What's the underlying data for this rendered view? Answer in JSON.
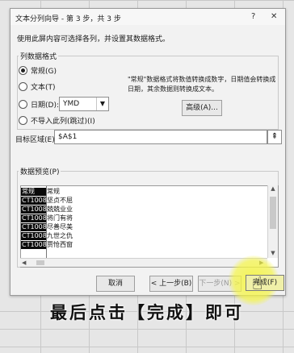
{
  "window": {
    "title": "文本分列向导 - 第 3 步，共 3 步",
    "help_glyph": "?",
    "close_glyph": "✕"
  },
  "description": "使用此屏内容可选择各列，并设置其数据格式。",
  "column_format": {
    "group_label": "列数据格式",
    "options": [
      {
        "label": "常规(G)",
        "selected": true
      },
      {
        "label": "文本(T)",
        "selected": false
      },
      {
        "label": "日期(D):",
        "selected": false
      },
      {
        "label": "不导入此列(跳过)(I)",
        "selected": false
      }
    ],
    "date_format": "YMD",
    "note": "\"常规\"数据格式将数值转换成数字，日期值会转换成日期，其余数据则转换成文本。",
    "advanced_button": "高级(A)..."
  },
  "destination": {
    "label": "目标区域(E):",
    "value": "$A$1",
    "collapse_glyph": "⇞"
  },
  "preview": {
    "group_label": "数据预览(P)",
    "headers": [
      "常规",
      "常规"
    ],
    "rows": [
      [
        "CT10080",
        "坚贞不屈"
      ],
      [
        "CT10081",
        "兢兢业业"
      ],
      [
        "CT10082",
        "将门有将"
      ],
      [
        "CT10083",
        "尽善尽美"
      ],
      [
        "CT10084",
        "九世之仇"
      ],
      [
        "CT10085",
        "贾怆西窗"
      ]
    ]
  },
  "buttons": {
    "cancel": "取消",
    "back": "< 上一步(B)",
    "next": "下一步(N) >",
    "finish": "完成(F)"
  },
  "caption": "最后点击【完成】即可",
  "colors": {
    "highlight": "#f5f546",
    "dialog_bg": "#f2f2f2"
  }
}
